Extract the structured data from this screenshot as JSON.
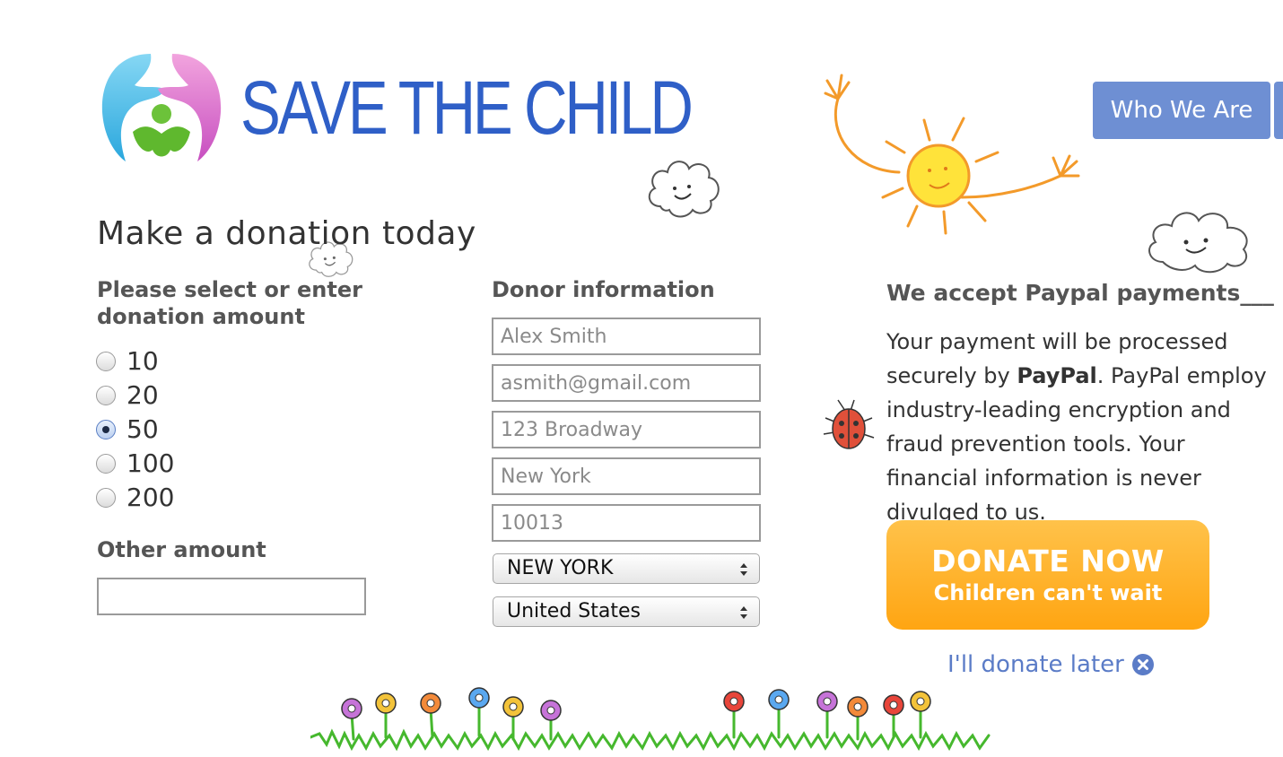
{
  "brand": {
    "name": "SAVE THE CHILD",
    "colors": {
      "brand_blue": "#2f5fc7",
      "nav_blue": "#6e8fd3",
      "donate_orange": "#ffa512",
      "link_blue": "#5b7cc7"
    }
  },
  "nav": {
    "items": [
      {
        "label": "Who We Are"
      }
    ]
  },
  "main": {
    "title": "Make a donation today",
    "amount_section": {
      "heading": "Please select or enter donation amount",
      "options": [
        {
          "label": "10",
          "checked": false
        },
        {
          "label": "20",
          "checked": false
        },
        {
          "label": "50",
          "checked": true
        },
        {
          "label": "100",
          "checked": false
        },
        {
          "label": "200",
          "checked": false
        }
      ],
      "other_label": "Other amount",
      "other_value": ""
    },
    "donor": {
      "heading": "Donor information",
      "fields": {
        "name_placeholder": "Alex Smith",
        "email_placeholder": "asmith@gmail.com",
        "address_placeholder": "123 Broadway",
        "city_placeholder": "New York",
        "zip_placeholder": "10013"
      },
      "state_selected": "NEW YORK",
      "country_selected": "United States"
    },
    "paypal": {
      "heading": "We accept Paypal payments___",
      "text_before": "Your payment will be processed securely by ",
      "text_bold": "PayPal",
      "text_after": ". PayPal employ industry-leading encryption and fraud prevention tools. Your financial information is never divulged to us."
    },
    "donate": {
      "main_label": "DONATE NOW",
      "sub_label": "Children can't wait"
    },
    "later_link": {
      "label": "I'll donate later",
      "icon": "close-circle-icon"
    }
  },
  "decorations": {
    "icons": [
      "logo-icon",
      "cloud-icon",
      "sun-icon",
      "ladybug-icon",
      "flowers-icon"
    ]
  }
}
